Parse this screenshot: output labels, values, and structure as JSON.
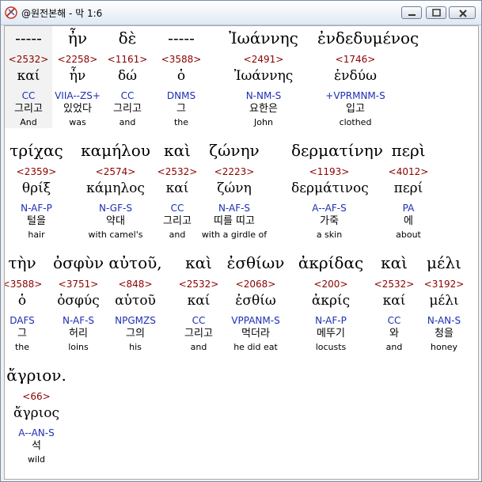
{
  "window": {
    "title": "@원전본해 - 막 1:6"
  },
  "words": [
    {
      "greek": "-----",
      "strong": "<2532>",
      "lemma": "καί",
      "parse": "CC",
      "korean": "그리고",
      "english": "And",
      "selected": true
    },
    {
      "greek": "ἦν",
      "strong": "<2258>",
      "lemma": "ἦν",
      "parse": "VIIA--ZS+",
      "korean": "있었다",
      "english": "was"
    },
    {
      "greek": "δὲ",
      "strong": "<1161>",
      "lemma": "δώ",
      "parse": "CC",
      "korean": "그리고",
      "english": "and"
    },
    {
      "greek": "-----",
      "strong": "<3588>",
      "lemma": "ὁ",
      "parse": "DNMS",
      "korean": "그",
      "english": "the"
    },
    {
      "greek": "Ἰωάννης",
      "strong": "<2491>",
      "lemma": "Ἰωάννης",
      "parse": "N-NM-S",
      "korean": "요한은",
      "english": "John"
    },
    {
      "greek": "ἐνδεδυμένος",
      "strong": "<1746>",
      "lemma": "ἐνδύω",
      "parse": "+VPRMNM-S",
      "korean": "입고",
      "english": "clothed"
    },
    {
      "greek": "τρίχας",
      "strong": "<2359>",
      "lemma": "θρίξ",
      "parse": "N-AF-P",
      "korean": "털을",
      "english": "hair"
    },
    {
      "greek": "καμήλου",
      "strong": "<2574>",
      "lemma": "κάμηλος",
      "parse": "N-GF-S",
      "korean": "약대",
      "english": "with camel's"
    },
    {
      "greek": "καὶ",
      "strong": "<2532>",
      "lemma": "καί",
      "parse": "CC",
      "korean": "그리고",
      "english": "and"
    },
    {
      "greek": "ζώνην",
      "strong": "<2223>",
      "lemma": "ζώνη",
      "parse": "N-AF-S",
      "korean": "띠를 띠고",
      "english": "with a girdle of"
    },
    {
      "greek": "δερματίνην",
      "strong": "<1193>",
      "lemma": "δερμάτινος",
      "parse": "A--AF-S",
      "korean": "가죽",
      "english": "a skin"
    },
    {
      "greek": "περὶ",
      "strong": "<4012>",
      "lemma": "περί",
      "parse": "PA",
      "korean": "에",
      "english": "about"
    },
    {
      "greek": "τὴν",
      "strong": "<3588>",
      "lemma": "ὁ",
      "parse": "DAFS",
      "korean": "그",
      "english": "the"
    },
    {
      "greek": "ὀσφὺν",
      "strong": "<3751>",
      "lemma": "ὀσφύς",
      "parse": "N-AF-S",
      "korean": "허리",
      "english": "loins"
    },
    {
      "greek": "αὐτοῦ,",
      "strong": "<848>",
      "lemma": "αὑτοῦ",
      "parse": "NPGMZS",
      "korean": "그의",
      "english": "his"
    },
    {
      "greek": "καὶ",
      "strong": "<2532>",
      "lemma": "καί",
      "parse": "CC",
      "korean": "그리고",
      "english": "and"
    },
    {
      "greek": "ἐσθίων",
      "strong": "<2068>",
      "lemma": "ἐσθίω",
      "parse": "VPPANM-S",
      "korean": "먹더라",
      "english": "he did eat"
    },
    {
      "greek": "ἀκρίδας",
      "strong": "<200>",
      "lemma": "ἀκρίς",
      "parse": "N-AF-P",
      "korean": "메뚜기",
      "english": "locusts"
    },
    {
      "greek": "καὶ",
      "strong": "<2532>",
      "lemma": "καί",
      "parse": "CC",
      "korean": "와",
      "english": "and"
    },
    {
      "greek": "μέλι",
      "strong": "<3192>",
      "lemma": "μέλι",
      "parse": "N-AN-S",
      "korean": "청을",
      "english": "honey"
    },
    {
      "greek": "ἄγριον.",
      "strong": "<66>",
      "lemma": "ἄγριος",
      "parse": "A--AN-S",
      "korean": "석",
      "english": "wild"
    }
  ]
}
